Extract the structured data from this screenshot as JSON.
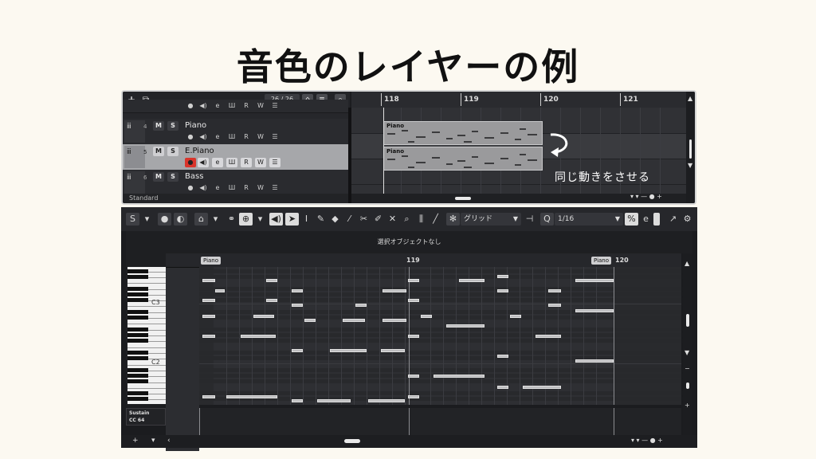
{
  "slide_title": "音色のレイヤーの例",
  "annotation": "同じ動きをさせる",
  "top_toolbar": {
    "add_label": "+",
    "counter": "26 / 26"
  },
  "tracks": [
    {
      "number": "4",
      "name": "Piano",
      "m": "M",
      "s": "S",
      "r": "R",
      "w": "W"
    },
    {
      "number": "5",
      "name": "E.Piano",
      "m": "M",
      "s": "S",
      "r": "R",
      "w": "W"
    },
    {
      "number": "6",
      "name": "Bass",
      "m": "M",
      "s": "S",
      "r": "R",
      "w": "W"
    }
  ],
  "track_footer": {
    "preset": "Standard"
  },
  "ruler": {
    "bars": [
      "118",
      "119",
      "120",
      "121"
    ]
  },
  "parts": [
    {
      "name": "Piano"
    },
    {
      "name": "Piano"
    }
  ],
  "key_editor": {
    "snap_mode": "グリッド",
    "quantize_label": "Q",
    "quantize_value": "1/16",
    "status": "選択オブジェクトなし",
    "ruler_bars": [
      "119",
      "120"
    ],
    "part_tags": [
      "Piano",
      "Piano"
    ],
    "octave_labels": [
      "C3",
      "C2"
    ],
    "cc_lane": {
      "line1": "Sustain",
      "line2": "CC 64"
    }
  },
  "colors": {
    "accent_record": "#d9342b",
    "selected_track": "#a6a7aa",
    "background": "#fcf9f1"
  }
}
